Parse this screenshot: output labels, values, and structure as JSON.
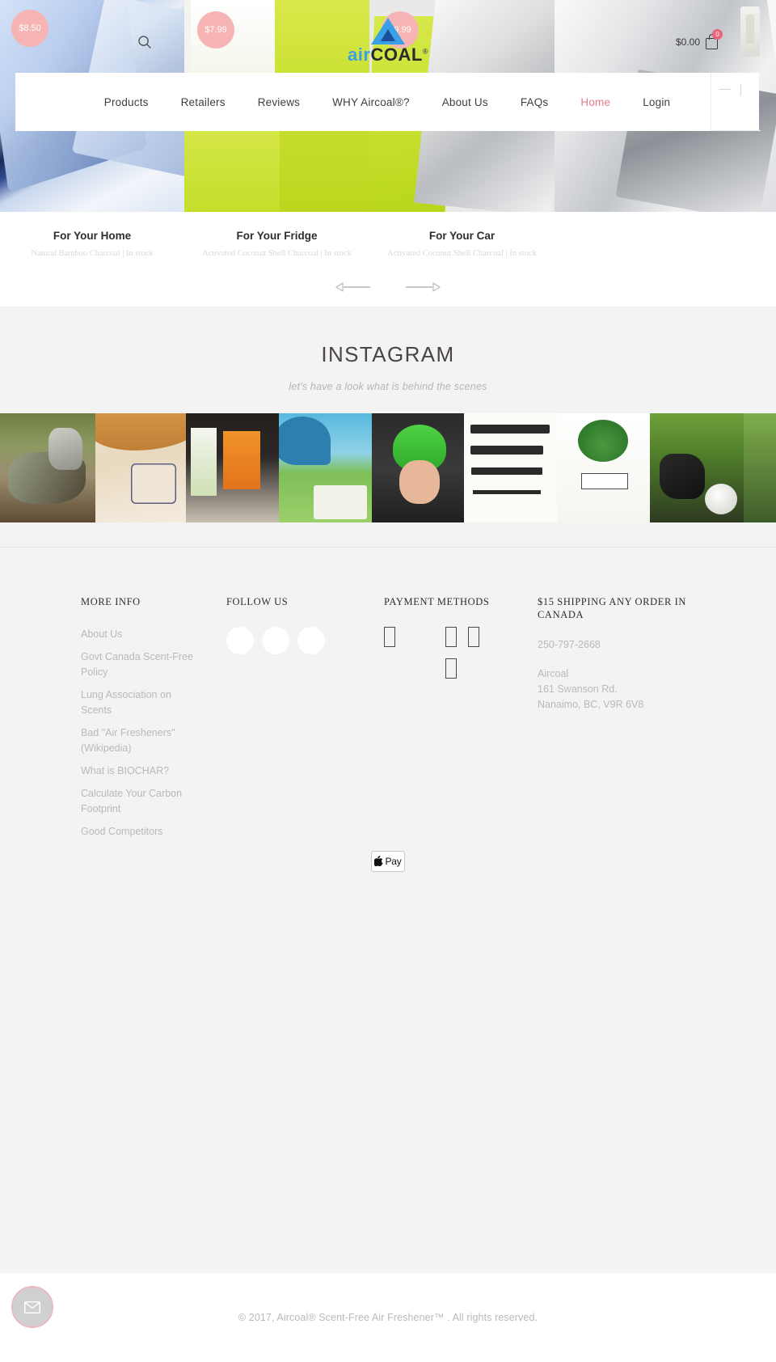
{
  "header": {
    "logo": {
      "part_a": "air",
      "part_b": "COAL",
      "trademark": "®"
    },
    "search_icon": "search-icon",
    "cart": {
      "total": "$0.00",
      "count": "0",
      "icon": "shopping-bag-icon"
    },
    "nav": [
      {
        "label": "Products",
        "active": false
      },
      {
        "label": "Retailers",
        "active": false
      },
      {
        "label": "Reviews",
        "active": false
      },
      {
        "label": "WHY Aircoal®?",
        "active": false
      },
      {
        "label": "About Us",
        "active": false
      },
      {
        "label": "FAQs",
        "active": false
      },
      {
        "label": "Home",
        "active": true
      },
      {
        "label": "Login",
        "active": false
      }
    ]
  },
  "carousel": {
    "products": [
      {
        "price": "$8.50",
        "title": "For Your Home",
        "meta": "Natural Bamboo Charcoal  |  In stock"
      },
      {
        "price": "$7.99",
        "title": "For Your Fridge",
        "meta": "Activated Coconut Shell Charcoal  |  In stock"
      },
      {
        "price": "$9.99",
        "title": "For Your Car",
        "meta": "Activated Coconut Shell Charcoal  |  In stock"
      }
    ],
    "prev_label": "previous-slide",
    "next_label": "next-slide"
  },
  "instagram": {
    "title": "INSTAGRAM",
    "subtitle": "let's have a look what is behind the scenes"
  },
  "footer": {
    "more_info": {
      "heading": "MORE INFO",
      "links": [
        "About Us",
        "Govt Canada Scent-Free Policy",
        "Lung Association on Scents",
        "Bad \"Air Fresheners\" (Wikipedia)",
        "What is BIOCHAR?",
        "Calculate Your Carbon Footprint",
        "Good Competitors"
      ]
    },
    "follow_us": {
      "heading": "FOLLOW US",
      "icons": [
        "facebook-icon",
        "twitter-icon",
        "instagram-icon"
      ]
    },
    "payment_methods": {
      "heading": "PAYMENT METHODS",
      "icons": [
        "payment-icon-1",
        "payment-icon-2",
        "payment-icon-3",
        "payment-icon-4"
      ]
    },
    "shipping": {
      "heading": "$15 SHIPPING ANY ORDER IN CANADA",
      "phone": "250-797-2668",
      "company": "Aircoal",
      "address_line1": "161 Swanson Rd.",
      "address_line2": "Nanaimo, BC, V9R 6V8"
    },
    "apple_pay": {
      "glyph": "",
      "label": "Pay"
    },
    "copyright": "© 2017, Aircoal® Scent-Free Air Freshener™ . All rights reserved."
  },
  "chat": {
    "icon": "envelope-icon",
    "accent": "#e9b9bf"
  }
}
